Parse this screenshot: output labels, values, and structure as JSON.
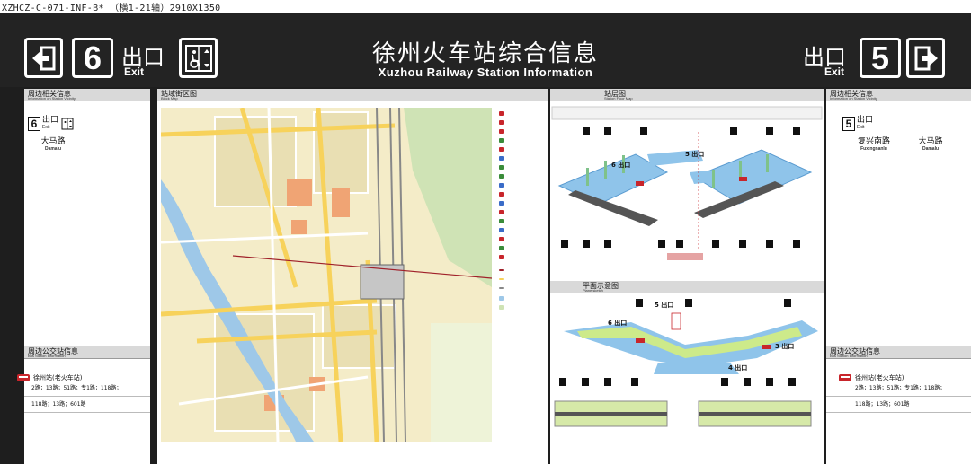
{
  "spec_code": "XZHCZ-C-071-INF-B* （横1-21轴）2910X1350",
  "header": {
    "title_cn": "徐州火车站综合信息",
    "title_en": "Xuzhou Railway Station Information",
    "left_exit": {
      "number": "6",
      "label_cn": "出口",
      "label_en": "Exit",
      "arrow_icon": "exit-left-arrow-icon",
      "extra_icon": "accessible-elevator-icon"
    },
    "right_exit": {
      "number": "5",
      "label_cn": "出口",
      "label_en": "Exit",
      "arrow_icon": "exit-right-arrow-icon"
    }
  },
  "left_panel": {
    "vicinity_head_cn": "周边相关信息",
    "vicinity_head_en": "Information on Station Vicinity",
    "exit_number": "6",
    "exit_label_cn": "出口",
    "exit_label_en": "Exit",
    "roads": [
      {
        "cn": "大马路",
        "en": "Damalu"
      }
    ],
    "bus_head_cn": "周边公交站信息",
    "bus_head_en": "Bus Station Information",
    "bus_stop": "徐州站(老火车站)",
    "bus_lines_1": "2路；13路；51路；专1路；118路；",
    "bus_lines_2": "118路；13路；601路"
  },
  "right_panel": {
    "vicinity_head_cn": "周边相关信息",
    "vicinity_head_en": "Information on Station Vicinity",
    "exit_number": "5",
    "exit_label_cn": "出口",
    "exit_label_en": "Exit",
    "roads": [
      {
        "cn": "复兴南路",
        "en": "Fuxingnanlu"
      },
      {
        "cn": "大马路",
        "en": "Damalu"
      }
    ],
    "bus_head_cn": "周边公交站信息",
    "bus_head_en": "Bus Station Information",
    "bus_stop": "徐州站(老火车站)",
    "bus_lines_1": "2路；13路；51路；专1路；118路；",
    "bus_lines_2": "118路；13路；601路"
  },
  "block_map": {
    "head_cn": "站域街区图",
    "head_en": "Block Map"
  },
  "floor_map": {
    "head_cn": "站层图",
    "head_en": "Station Floor Map",
    "exit_6_label": "6 出口",
    "exit_5_label": "5 出口",
    "exit_3_label": "3 出口",
    "exit_4_label": "4 出口"
  },
  "plane_sketch": {
    "head_cn": "平面示意图",
    "head_en": "Plane sketch"
  },
  "colors": {
    "header_bg": "#232323",
    "accent_red": "#c8252b",
    "track_green": "#cfe9a0",
    "concourse_blue": "#8fc4ea"
  }
}
